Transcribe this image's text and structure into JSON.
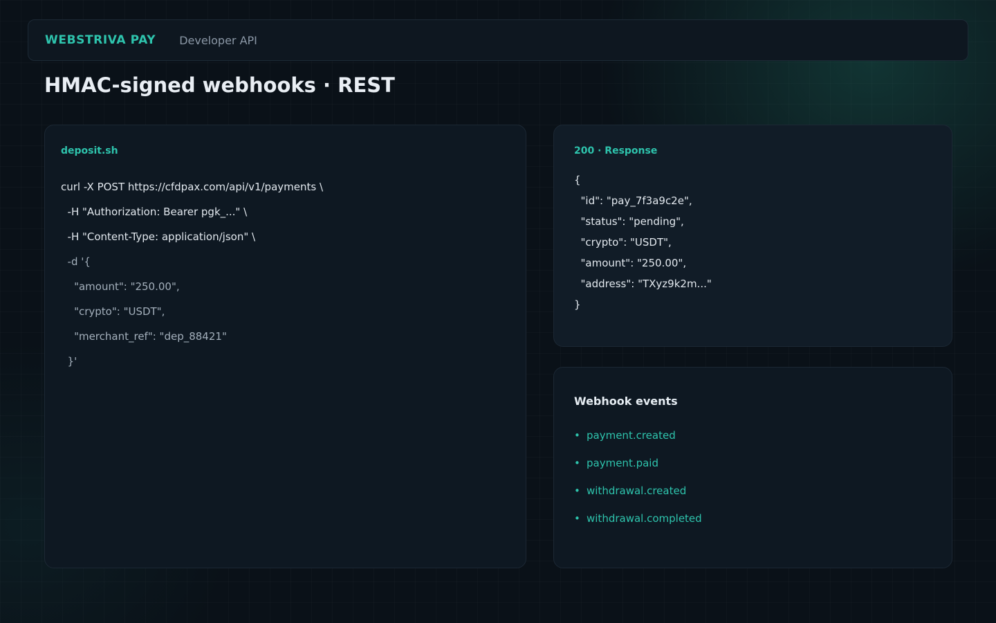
{
  "header": {
    "brand": "WEBSTRIVA PAY",
    "section": "Developer API"
  },
  "page": {
    "title": "HMAC-signed webhooks · REST"
  },
  "request": {
    "filename": "deposit.sh",
    "lines": [
      "curl -X POST https://cfdpax.com/api/v1/payments \\",
      "  -H \"Authorization: Bearer pgk_...\" \\",
      "  -H \"Content-Type: application/json\" \\",
      "  -d '{",
      "    \"amount\": \"250.00\",",
      "    \"crypto\": \"USDT\",",
      "    \"merchant_ref\": \"dep_88421\"",
      "  }'"
    ]
  },
  "response": {
    "label": "200 · Response",
    "lines": [
      "{",
      "  \"id\": \"pay_7f3a9c2e\",",
      "  \"status\": \"pending\",",
      "  \"crypto\": \"USDT\",",
      "  \"amount\": \"250.00\",",
      "  \"address\": \"TXyz9k2m...\"",
      "}"
    ]
  },
  "webhooks": {
    "title": "Webhook events",
    "bullet": "•",
    "events": [
      "payment.created",
      "payment.paid",
      "withdrawal.created",
      "withdrawal.completed"
    ]
  },
  "colors": {
    "accent": "#2ec4ad",
    "background": "#0a1118",
    "card": "#0e1822"
  }
}
